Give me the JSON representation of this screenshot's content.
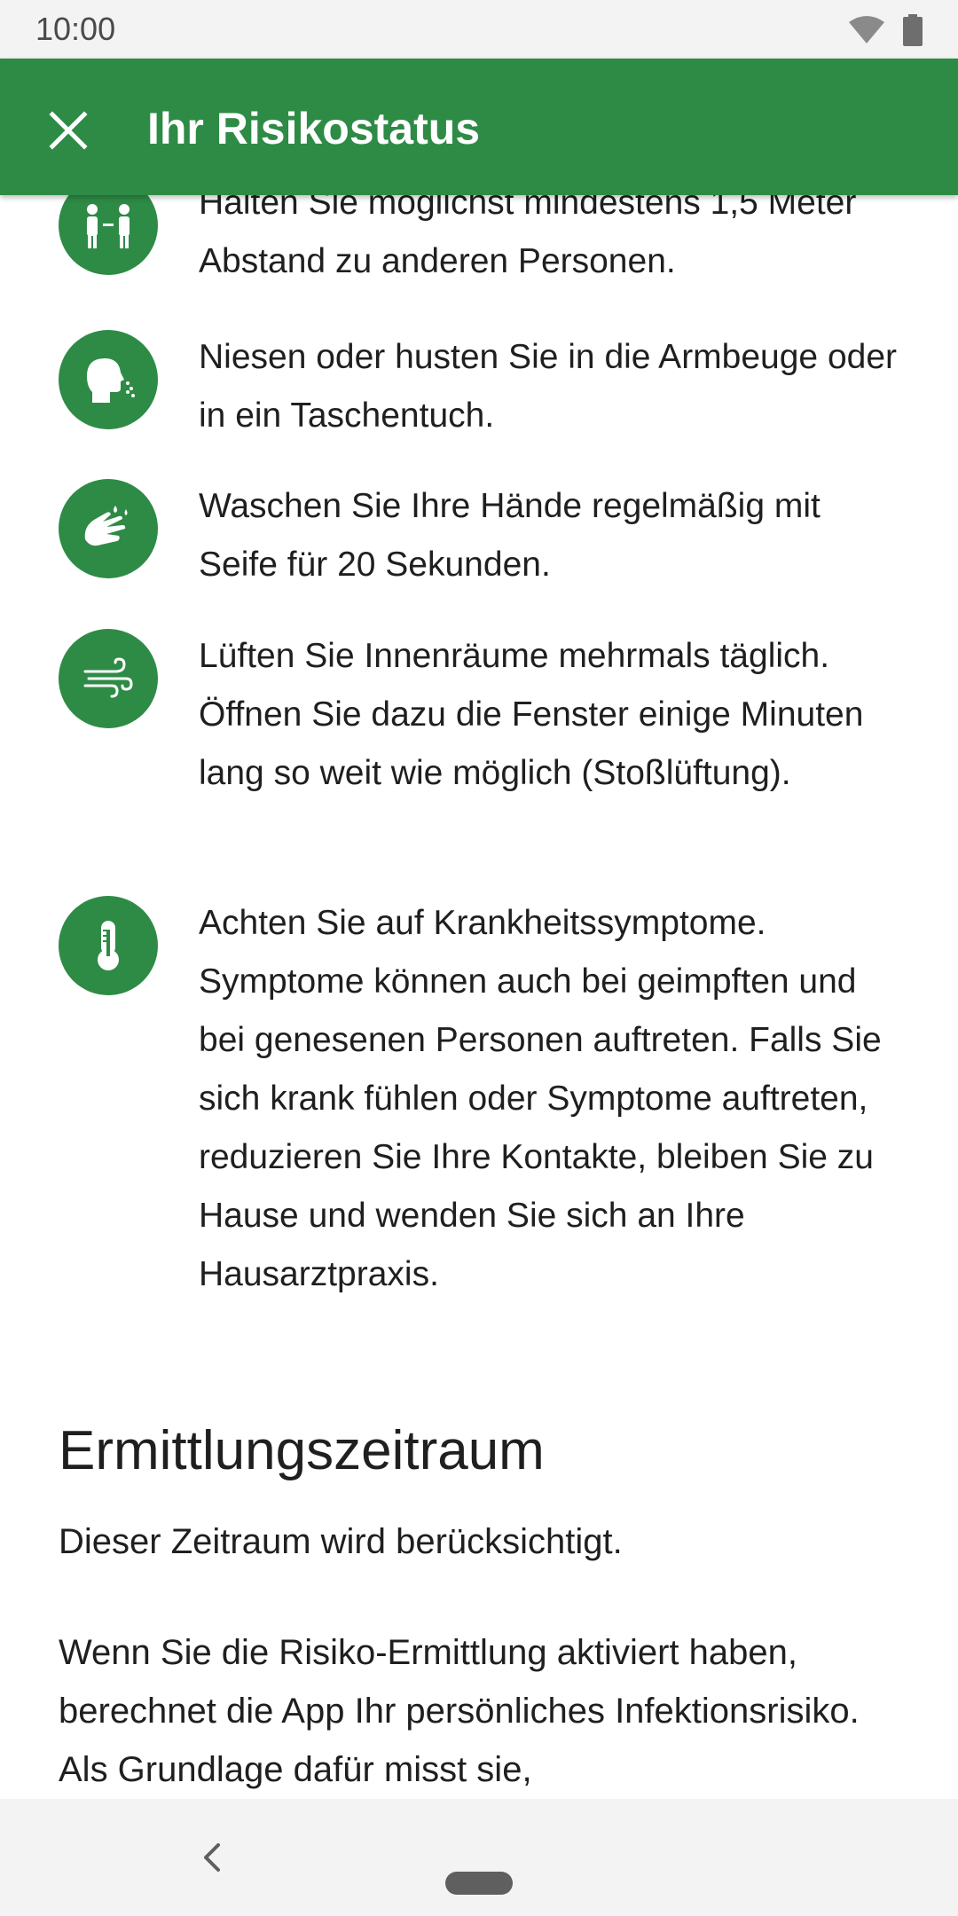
{
  "status_bar": {
    "time": "10:00"
  },
  "app_bar": {
    "title": "Ihr Risikostatus"
  },
  "tips": [
    {
      "icon": "distance-icon",
      "text": "Halten Sie möglichst mindestens 1,5 Meter Abstand zu anderen Personen."
    },
    {
      "icon": "sneeze-icon",
      "text": "Niesen oder husten Sie in die Armbeuge oder in ein Taschentuch."
    },
    {
      "icon": "handwash-icon",
      "text": "Waschen Sie Ihre Hände regelmäßig mit Seife für 20 Sekunden."
    },
    {
      "icon": "air-icon",
      "text": "Lüften Sie Innenräume mehrmals täglich. Öffnen Sie dazu die Fenster einige Minuten lang so weit wie möglich (Stoßlüftung)."
    },
    {
      "icon": "thermometer-icon",
      "text": "Achten Sie auf Krankheitssymptome. Symptome können auch bei geimpften und bei genesenen Personen auftreten. Falls Sie sich krank fühlen oder Symptome auftreten, reduzieren Sie Ihre Kontakte, bleiben Sie zu Hause und wenden Sie sich an Ihre Hausarztpraxis."
    }
  ],
  "section": {
    "title": "Ermittlungszeitraum",
    "subtitle": "Dieser Zeitraum wird berücksichtigt.",
    "body": "Wenn Sie die Risiko-Ermittlung aktiviert haben, berechnet die App Ihr persönliches Infektionsrisiko. Als Grundlage dafür misst sie,"
  },
  "colors": {
    "accent": "#2e8b46",
    "background": "#ffffff",
    "system_bar": "#f3f3f3"
  }
}
